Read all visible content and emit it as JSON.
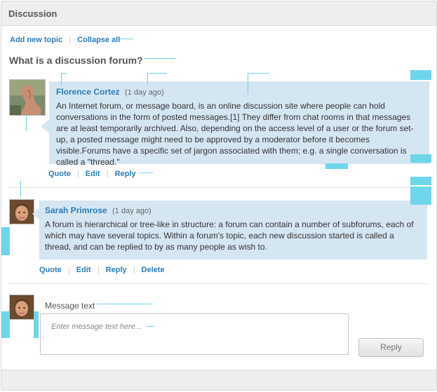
{
  "header": {
    "title": "Discussion"
  },
  "toolbar": {
    "add_topic": "Add new topic",
    "collapse_all": "Collapse all"
  },
  "topic": {
    "title": "What is a discussion forum?"
  },
  "posts": [
    {
      "author": "Florence Cortez",
      "time": "(1 day ago)",
      "text": "An Internet forum, or message board, is an online discussion site where people can hold conversations in the form of posted messages.[1] They differ from chat rooms in that messages are at least temporarily archived. Also, depending on the access level of a user or the forum set-up, a posted message might need to be approved by a moderator before it becomes visible.Forums have a specific set of jargon associated with them; e.g. a single conversation is called a \"thread.\"",
      "actions": [
        "Quote",
        "Edit",
        "Reply"
      ]
    },
    {
      "author": "Sarah Primrose",
      "time": "(1 day ago)",
      "text": "A forum is hierarchical or tree-like in structure: a forum can contain a number of subforums, each of which may have several topics. Within a forum's topic, each new discussion started is called a thread, and can be replied to by as many people as wish to.",
      "actions": [
        "Quote",
        "Edit",
        "Reply",
        "Delete"
      ]
    }
  ],
  "composer": {
    "label": "Message text",
    "placeholder": "Enter message text here...",
    "button": "Reply"
  },
  "colors": {
    "accent": "#2a7bb8",
    "bubble": "#d5e6f3",
    "annotation": "#6fd6ea"
  }
}
